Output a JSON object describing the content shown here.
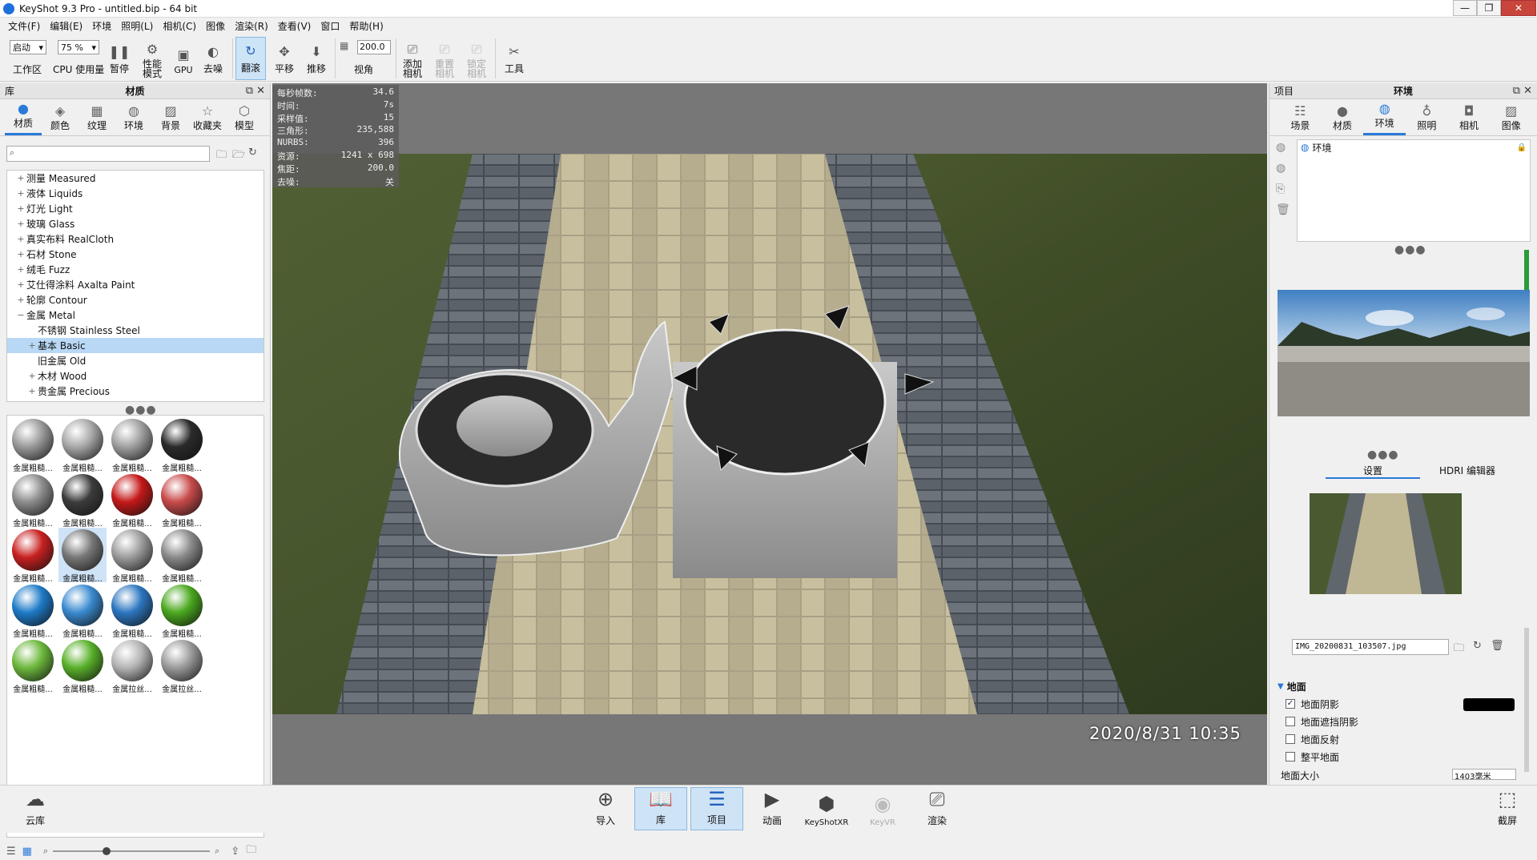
{
  "window": {
    "title": "KeyShot 9.3 Pro  - untitled.bip  - 64 bit",
    "min": "—",
    "max": "❐",
    "close": "✕"
  },
  "menu": [
    "文件(F)",
    "编辑(E)",
    "环境",
    "照明(L)",
    "相机(C)",
    "图像",
    "渲染(R)",
    "查看(V)",
    "窗口",
    "帮助(H)"
  ],
  "toolbar": {
    "workspace_select": "启动",
    "workspace_label": "工作区",
    "cpu_select": "75 %",
    "cpu_label": "CPU 使用量",
    "pause": "暂停",
    "perf_mode": "性能\n模式",
    "gpu": "GPU",
    "denoise": "去噪",
    "tumble": "翻滚",
    "pan": "平移",
    "dolly": "推移",
    "fov_value": "200.0",
    "fov_label": "视角",
    "add_camera": "添加\n相机",
    "reset_camera": "重置\n相机",
    "lock_camera": "锁定\n相机",
    "tools": "工具"
  },
  "library": {
    "panel_title": "库",
    "panel_center": "材质",
    "tabs": [
      "材质",
      "颜色",
      "纹理",
      "环境",
      "背景",
      "收藏夹",
      "模型"
    ],
    "search_placeholder": "",
    "tree": [
      {
        "pm": "+",
        "label": "测量 Measured",
        "indent": 0
      },
      {
        "pm": "+",
        "label": "液体 Liquids",
        "indent": 0
      },
      {
        "pm": "+",
        "label": "灯光 Light",
        "indent": 0
      },
      {
        "pm": "+",
        "label": "玻璃 Glass",
        "indent": 0
      },
      {
        "pm": "+",
        "label": "真实布料 RealCloth",
        "indent": 0
      },
      {
        "pm": "+",
        "label": "石材 Stone",
        "indent": 0
      },
      {
        "pm": "+",
        "label": "绒毛 Fuzz",
        "indent": 0
      },
      {
        "pm": "+",
        "label": "艾仕得涂料 Axalta Paint",
        "indent": 0
      },
      {
        "pm": "+",
        "label": "轮廓 Contour",
        "indent": 0
      },
      {
        "pm": "−",
        "label": "金属 Metal",
        "indent": 0
      },
      {
        "pm": "",
        "label": "不锈钢 Stainless Steel",
        "indent": 1
      },
      {
        "pm": "+",
        "label": "基本 Basic",
        "indent": 1,
        "sel": true
      },
      {
        "pm": "",
        "label": "旧金属 Old",
        "indent": 1
      },
      {
        "pm": "+",
        "label": "木材 Wood",
        "indent": 1
      },
      {
        "pm": "+",
        "label": "贵金属 Precious",
        "indent": 1
      }
    ],
    "thumbnails": [
      {
        "label": "金属粗糙...",
        "color": "#9a9a9a"
      },
      {
        "label": "金属粗糙...",
        "color": "#a8a8a8"
      },
      {
        "label": "金属粗糙...",
        "color": "#a0a0a0"
      },
      {
        "label": "金属粗糙...",
        "color": "#2a2a2a"
      },
      {
        "label": "金属粗糙...",
        "color": "#8c8c8c"
      },
      {
        "label": "金属粗糙...",
        "color": "#3c3c3c"
      },
      {
        "label": "金属粗糙...",
        "color": "#c41818"
      },
      {
        "label": "金属粗糙...",
        "color": "#c84a4a"
      },
      {
        "label": "金属粗糙...",
        "color": "#c82020"
      },
      {
        "label": "金属粗糙...",
        "color": "#777777",
        "sel": true
      },
      {
        "label": "金属粗糙...",
        "color": "#9c9c9c"
      },
      {
        "label": "金属粗糙...",
        "color": "#8a8a8a"
      },
      {
        "label": "金属粗糙...",
        "color": "#1e7ac8"
      },
      {
        "label": "金属粗糙...",
        "color": "#3a8ad0"
      },
      {
        "label": "金属粗糙...",
        "color": "#2c76c0"
      },
      {
        "label": "金属粗糙...",
        "color": "#4aa81e"
      },
      {
        "label": "金属粗糙...",
        "color": "#6cb83c"
      },
      {
        "label": "金属粗糙...",
        "color": "#58b02a"
      },
      {
        "label": "金属拉丝...",
        "color": "#b4b4b4"
      },
      {
        "label": "金属拉丝...",
        "color": "#9a9a9a"
      }
    ]
  },
  "stats": [
    {
      "k": "每秒帧数:",
      "v": "34.6"
    },
    {
      "k": "时间:",
      "v": "7s"
    },
    {
      "k": "采样值:",
      "v": "15"
    },
    {
      "k": "三角形:",
      "v": "235,588"
    },
    {
      "k": "NURBS:",
      "v": "396"
    },
    {
      "k": "资源:",
      "v": "1241 x 698"
    },
    {
      "k": "焦距:",
      "v": "200.0"
    },
    {
      "k": "去噪:",
      "v": "关"
    }
  ],
  "viewport": {
    "timestamp": "2020/8/31  10:35"
  },
  "project": {
    "panel_title": "项目",
    "panel_center": "环境",
    "tabs": [
      "场景",
      "材质",
      "环境",
      "照明",
      "相机",
      "图像"
    ],
    "env_item": "环境",
    "subtabs": [
      "设置",
      "HDRI 编辑器"
    ],
    "bg_file": "IMG_20200831_103507.jpg",
    "ground_header": "地面",
    "ground_options": [
      {
        "label": "地面阴影",
        "checked": true
      },
      {
        "label": "地面遮挡阴影",
        "checked": false
      },
      {
        "label": "地面反射",
        "checked": false
      },
      {
        "label": "整平地面",
        "checked": false
      }
    ],
    "ground_size_label": "地面大小",
    "ground_size_value": "1403毫米"
  },
  "bottom": {
    "cloud": "云库",
    "import": "导入",
    "library": "库",
    "project": "项目",
    "animation": "动画",
    "keyshotxr": "KeyShotXR",
    "keyvr": "KeyVR",
    "render": "渲染",
    "screenshot": "截屏"
  },
  "colors": {
    "accent": "#2a7ad8",
    "selection": "#b9d8f5"
  }
}
